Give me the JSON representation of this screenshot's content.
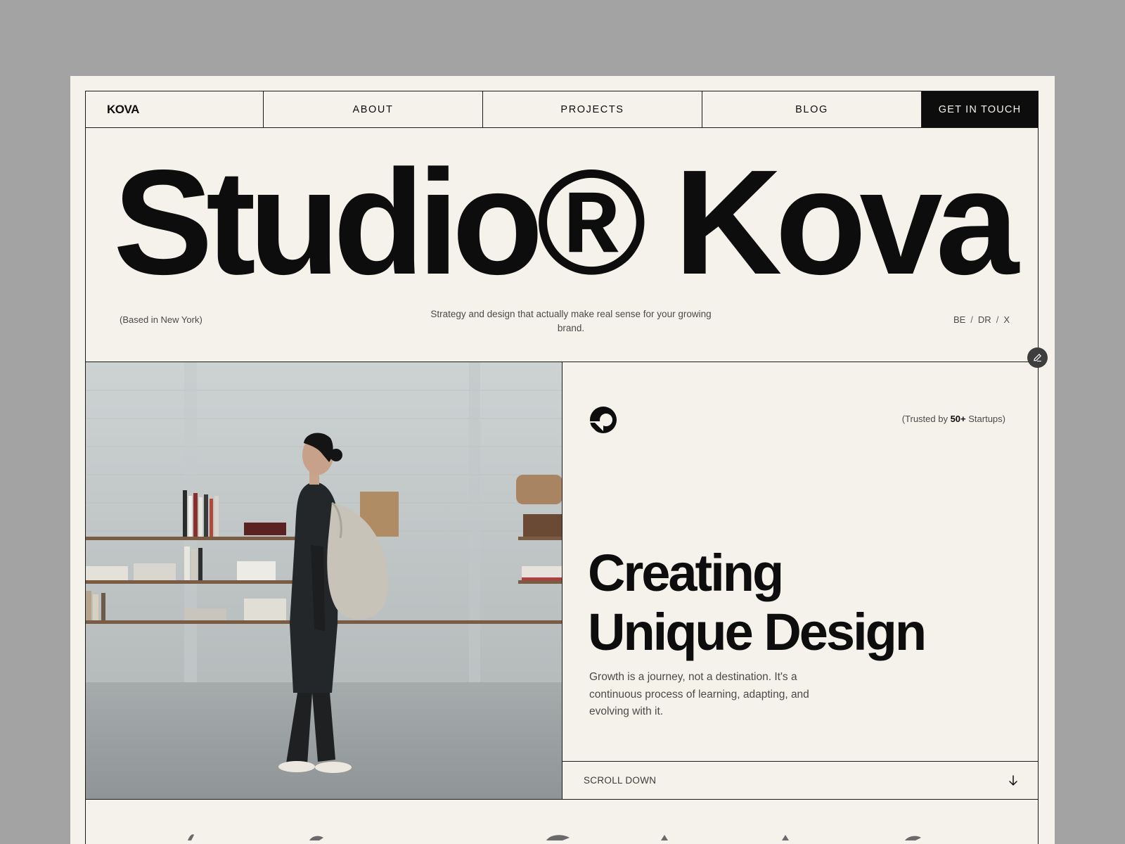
{
  "nav": {
    "logo": "KOVA",
    "items": [
      {
        "label": "ABOUT"
      },
      {
        "label": "PROJECTS"
      },
      {
        "label": "BLOG"
      }
    ],
    "cta": "GET IN TOUCH"
  },
  "hero": {
    "title": "Studio® Kova",
    "location": "(Based in New York)",
    "tagline": "Strategy and design that actually make real sense for your growing brand.",
    "socials": [
      "BE",
      "DR",
      "X"
    ],
    "separator": "/"
  },
  "panel": {
    "trusted_prefix": "(Trusted by ",
    "trusted_count": "50+",
    "trusted_suffix": " Startups)",
    "headline_line1": "Creating",
    "headline_line2": "Unique Design",
    "subcopy": "Growth is a journey, not a destination. It's a continuous process of learning, adapting, and evolving with it.",
    "scroll_label": "SCROLL DOWN"
  },
  "icons": {
    "edit": "pencil-icon",
    "brand": "brand-mark-icon",
    "scroll": "arrow-down-icon"
  },
  "colors": {
    "background": "#f5f1eb",
    "ink": "#0d0d0d",
    "outer": "#a3a3a3",
    "muted": "#4a4a4a"
  }
}
